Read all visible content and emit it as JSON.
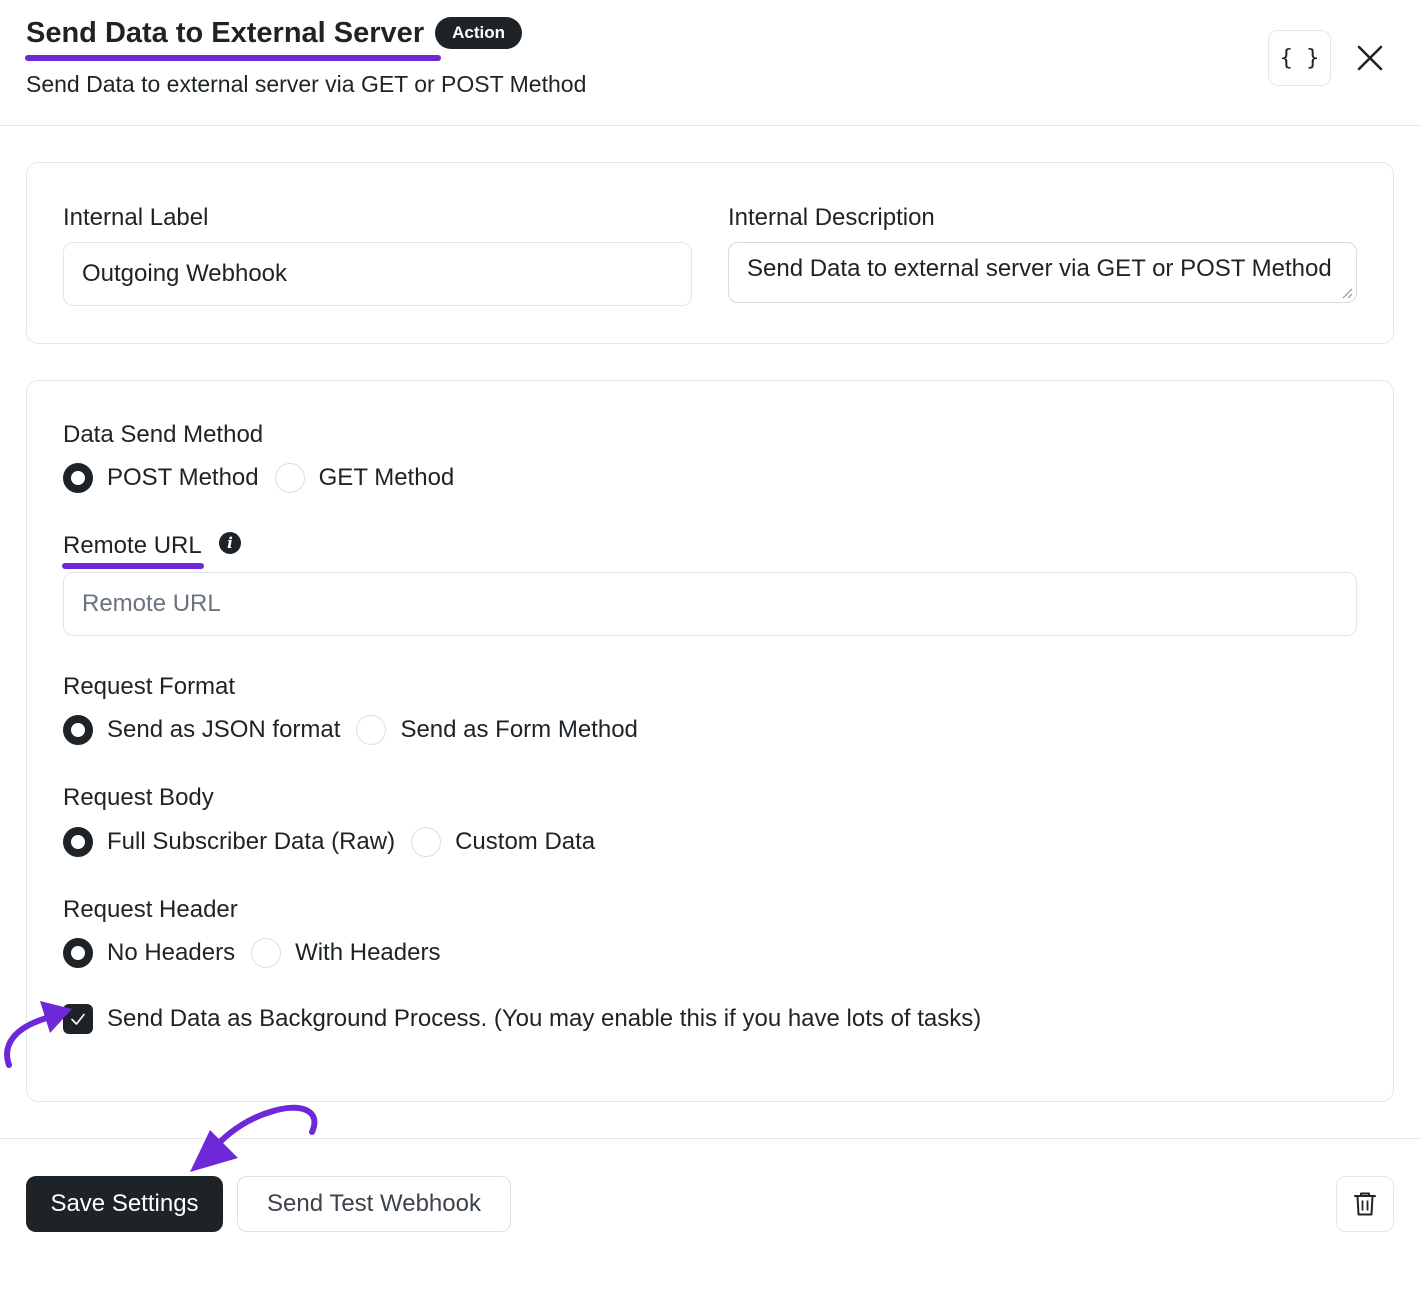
{
  "header": {
    "title": "Send Data to External Server",
    "badge": "Action",
    "subtitle": "Send Data to external server via GET or POST Method",
    "code_button_label": "{ }"
  },
  "general": {
    "internal_label": {
      "label": "Internal Label",
      "value": "Outgoing Webhook"
    },
    "internal_description": {
      "label": "Internal Description",
      "value": "Send Data to external server via GET or POST Method"
    }
  },
  "settings": {
    "data_send_method": {
      "label": "Data Send Method",
      "options": [
        "POST Method",
        "GET Method"
      ],
      "selected": "POST Method"
    },
    "remote_url": {
      "label": "Remote URL",
      "info_icon": "i",
      "placeholder": "Remote URL",
      "value": ""
    },
    "request_format": {
      "label": "Request Format",
      "options": [
        "Send as JSON format",
        "Send as Form Method"
      ],
      "selected": "Send as JSON format"
    },
    "request_body": {
      "label": "Request Body",
      "options": [
        "Full Subscriber Data (Raw)",
        "Custom Data"
      ],
      "selected": "Full Subscriber Data (Raw)"
    },
    "request_header": {
      "label": "Request Header",
      "options": [
        "No Headers",
        "With Headers"
      ],
      "selected": "No Headers"
    },
    "background_process": {
      "label": "Send Data as Background Process. (You may enable this if you have lots of tasks)",
      "checked": true
    }
  },
  "footer": {
    "save_label": "Save Settings",
    "test_label": "Send Test Webhook"
  },
  "colors": {
    "annotation": "#6d28d9",
    "primary": "#1d2327",
    "border": "#e5e7eb"
  }
}
